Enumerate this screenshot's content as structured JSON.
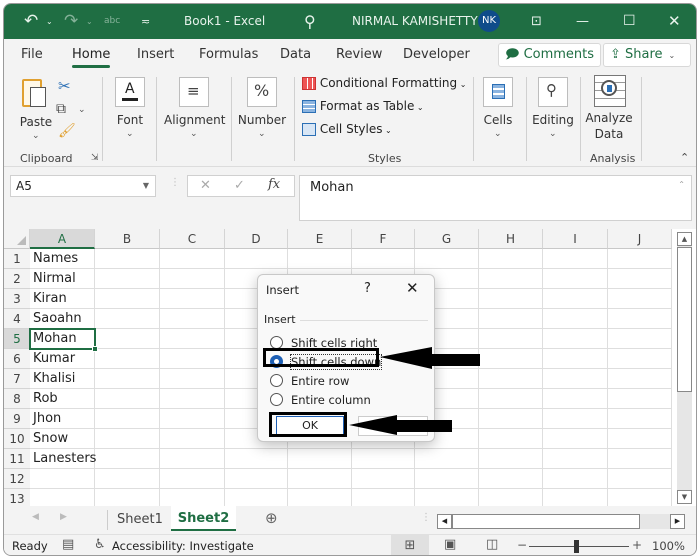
{
  "titlebar": {
    "title": "Book1  -  Excel",
    "user_name": "NIRMAL KAMISHETTY",
    "avatar_initials": "NK",
    "accent": "#1f6e43"
  },
  "menu_tabs": [
    "File",
    "Home",
    "Insert",
    "Formulas",
    "Data",
    "Review",
    "Developer"
  ],
  "active_tab": "Home",
  "actions": {
    "comments": "Comments",
    "share": "Share"
  },
  "ribbon": {
    "clipboard": {
      "paste": "Paste",
      "group": "Clipboard"
    },
    "font": "Font",
    "alignment": "Alignment",
    "number": "Number",
    "styles": {
      "conditional": "Conditional Formatting",
      "format_table": "Format as Table",
      "cell_styles": "Cell Styles",
      "group": "Styles"
    },
    "cells": "Cells",
    "editing": "Editing",
    "analyze": {
      "line1": "Analyze",
      "line2": "Data",
      "group": "Analysis"
    }
  },
  "formula_bar": {
    "name_box": "A5",
    "fx": "fx",
    "value": "Mohan"
  },
  "columns": [
    "A",
    "B",
    "C",
    "D",
    "E",
    "F",
    "G",
    "H",
    "I",
    "J"
  ],
  "rows": [
    "1",
    "2",
    "3",
    "4",
    "5",
    "6",
    "7",
    "8",
    "9",
    "10",
    "11",
    "12",
    "13"
  ],
  "column_a": [
    "Names",
    "Nirmal",
    "Kiran",
    "Saoahn",
    "Mohan",
    "Kumar",
    "Khalisi",
    "Rob",
    "Jhon",
    "Snow",
    "Lanesters",
    "",
    ""
  ],
  "selected_cell": "A5",
  "dialog": {
    "title": "Insert",
    "help": "?",
    "section": "Insert",
    "options": [
      "Shift cells right",
      "Shift cells down",
      "Entire row",
      "Entire column"
    ],
    "selected": "Shift cells down",
    "ok": "OK",
    "cancel": ""
  },
  "sheets": [
    "Sheet1",
    "Sheet2"
  ],
  "active_sheet": "Sheet2",
  "status": {
    "ready": "Ready",
    "accessibility": "Accessibility: Investigate",
    "zoom": "100%"
  }
}
